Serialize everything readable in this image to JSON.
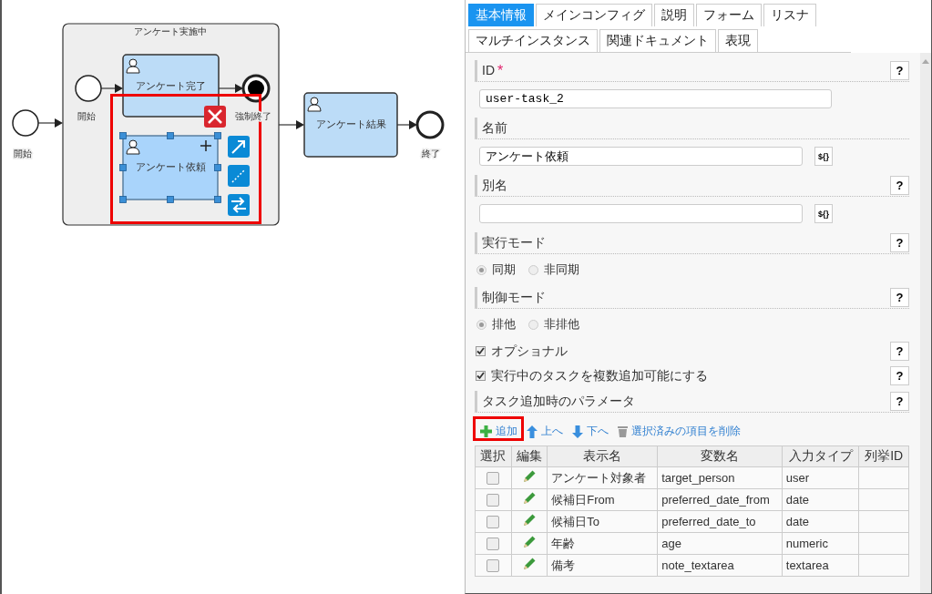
{
  "diagram": {
    "subprocess": {
      "label": "アンケート実施中"
    },
    "nodes": [
      {
        "kind": "start",
        "label": "開始"
      },
      {
        "kind": "start",
        "label": "開始"
      },
      {
        "kind": "task",
        "label": "アンケート完了",
        "selected": false
      },
      {
        "kind": "terminate",
        "label": "強制終了"
      },
      {
        "kind": "task",
        "label": "アンケート依頼",
        "selected": true
      },
      {
        "kind": "task",
        "label": "アンケート結果",
        "selected": false
      },
      {
        "kind": "end",
        "label": "終了"
      }
    ]
  },
  "tabs": [
    {
      "label": "基本情報",
      "selected": true
    },
    {
      "label": "メインコンフィグ",
      "selected": false
    },
    {
      "label": "説明",
      "selected": false
    },
    {
      "label": "フォーム",
      "selected": false
    },
    {
      "label": "リスナ",
      "selected": false
    },
    {
      "label": "マルチインスタンス",
      "selected": false
    },
    {
      "label": "関連ドキュメント",
      "selected": false
    },
    {
      "label": "表現",
      "selected": false
    }
  ],
  "sections": [
    {
      "kind": "field",
      "label": "ID",
      "required_mark": "*",
      "help": "?",
      "value": "user-task_2"
    },
    {
      "kind": "field",
      "label": "名前",
      "value": "アンケート依頼",
      "expr": "${}"
    },
    {
      "kind": "field",
      "label": "別名",
      "help": "?",
      "expr": "${}"
    },
    {
      "kind": "radios",
      "label": "実行モード",
      "help": "?",
      "options": [
        {
          "label": "同期",
          "selected": true
        },
        {
          "label": "非同期",
          "selected": false
        }
      ]
    },
    {
      "kind": "radios",
      "label": "制御モード",
      "help": "?",
      "options": [
        {
          "label": "排他",
          "selected": true
        },
        {
          "label": "非排他",
          "selected": false
        }
      ]
    },
    {
      "kind": "checkbox",
      "label": "オプショナル",
      "checked": true,
      "help": "?"
    },
    {
      "kind": "checkbox",
      "label": "実行中のタスクを複数追加可能にする",
      "checked": true,
      "help": "?"
    },
    {
      "kind": "header",
      "label": "タスク追加時のパラメータ",
      "help": "?"
    }
  ],
  "toolbar": [
    {
      "kind": "add",
      "label": "追加"
    },
    {
      "kind": "up",
      "label": "上へ"
    },
    {
      "kind": "down",
      "label": "下へ"
    },
    {
      "kind": "delete",
      "label": "選択済みの項目を削除"
    }
  ],
  "table": {
    "columns": [
      "選択",
      "編集",
      "表示名",
      "変数名",
      "入力タイプ",
      "列挙ID"
    ],
    "rows": [
      {
        "checked": false,
        "display_name": "アンケート対象者",
        "variable": "target_person",
        "input_type": "user"
      },
      {
        "checked": false,
        "display_name": "候補日From",
        "variable": "preferred_date_from",
        "input_type": "date"
      },
      {
        "checked": false,
        "display_name": "候補日To",
        "variable": "preferred_date_to",
        "input_type": "date"
      },
      {
        "checked": false,
        "display_name": "年齢",
        "variable": "age",
        "input_type": "numeric"
      },
      {
        "checked": false,
        "display_name": "備考",
        "variable": "note_textarea",
        "input_type": "textarea"
      }
    ]
  }
}
